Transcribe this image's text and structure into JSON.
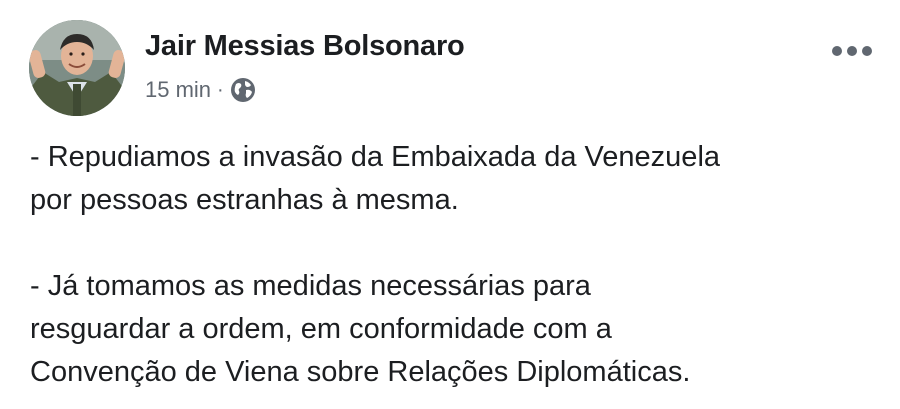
{
  "post": {
    "author": "Jair Messias Bolsonaro",
    "timestamp": "15 min",
    "separator": "·",
    "privacy_icon": "globe-icon",
    "more_icon": "more-options-icon",
    "avatar_icon": "profile-photo",
    "paragraphs": [
      "- Repudiamos a invasão da Embaixada da Venezuela\npor pessoas estranhas à mesma.",
      "- Já tomamos as medidas necessárias para\nresguardar a ordem, em conformidade com a\nConvenção de Viena sobre Relações Diplomáticas."
    ]
  },
  "colors": {
    "text": "#1c1e21",
    "secondary": "#606770",
    "background": "#ffffff"
  }
}
